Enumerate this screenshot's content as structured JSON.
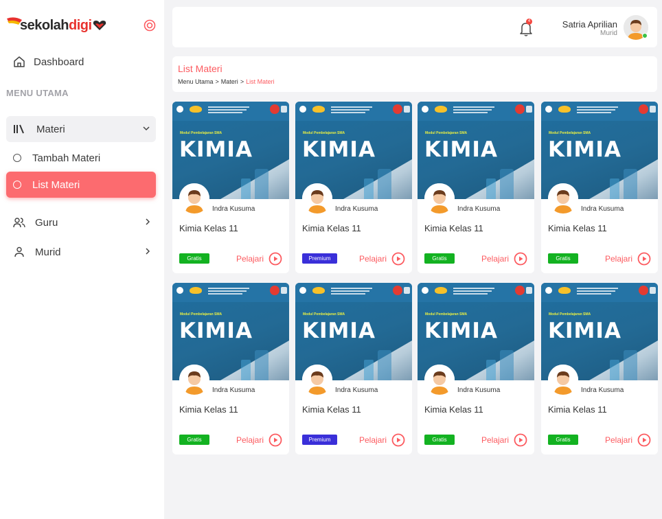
{
  "brand": {
    "part1": "sekolah",
    "part2": "digi",
    "colors": {
      "accent": "#fc6b6f",
      "red": "#e8322e",
      "green": "#13b221",
      "purple": "#3a2fd9"
    }
  },
  "sidebar": {
    "dashboard": "Dashboard",
    "section_title": "MENU UTAMA",
    "materi": "Materi",
    "sub_items": [
      "Tambah Materi",
      "List Materi"
    ],
    "active_sub": "List Materi",
    "guru": "Guru",
    "murid": "Murid"
  },
  "header": {
    "notification_count": "4",
    "user_name": "Satria Aprilian",
    "user_role": "Murid"
  },
  "page": {
    "title": "List Materi",
    "breadcrumb": [
      "Menu Utama",
      ">",
      "Materi",
      ">",
      "List Materi"
    ]
  },
  "cards": [
    {
      "cover_series": "Modul Pembelajaran SMA",
      "cover_subject": "KIMIA",
      "author": "Indra Kusuma",
      "title": "Kimia Kelas 11",
      "badge": "Gratis",
      "action": "Pelajari"
    },
    {
      "cover_series": "Modul Pembelajaran SMA",
      "cover_subject": "KIMIA",
      "author": "Indra Kusuma",
      "title": "Kimia Kelas 11",
      "badge": "Premium",
      "action": "Pelajari"
    },
    {
      "cover_series": "Modul Pembelajaran SMA",
      "cover_subject": "KIMIA",
      "author": "Indra Kusuma",
      "title": "Kimia Kelas 11",
      "badge": "Gratis",
      "action": "Pelajari"
    },
    {
      "cover_series": "Modul Pembelajaran SMA",
      "cover_subject": "KIMIA",
      "author": "Indra Kusuma",
      "title": "Kimia Kelas 11",
      "badge": "Gratis",
      "action": "Pelajari"
    },
    {
      "cover_series": "Modul Pembelajaran SMA",
      "cover_subject": "KIMIA",
      "author": "Indra Kusuma",
      "title": "Kimia Kelas 11",
      "badge": "Gratis",
      "action": "Pelajari"
    },
    {
      "cover_series": "Modul Pembelajaran SMA",
      "cover_subject": "KIMIA",
      "author": "Indra Kusuma",
      "title": "Kimia Kelas 11",
      "badge": "Premium",
      "action": "Pelajari"
    },
    {
      "cover_series": "Modul Pembelajaran SMA",
      "cover_subject": "KIMIA",
      "author": "Indra Kusuma",
      "title": "Kimia Kelas 11",
      "badge": "Gratis",
      "action": "Pelajari"
    },
    {
      "cover_series": "Modul Pembelajaran SMA",
      "cover_subject": "KIMIA",
      "author": "Indra Kusuma",
      "title": "Kimia Kelas 11",
      "badge": "Gratis",
      "action": "Pelajari"
    }
  ]
}
